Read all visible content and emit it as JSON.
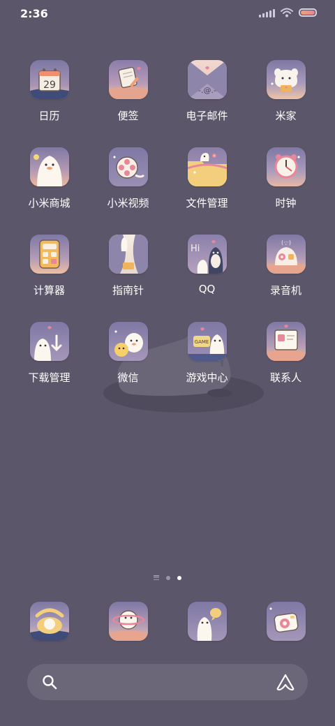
{
  "status_bar": {
    "time": "2:36",
    "signal_icon": "signal-icon",
    "wifi_icon": "wifi-icon",
    "battery_icon": "battery-icon"
  },
  "apps": [
    {
      "label": "日历",
      "icon": "calendar-icon",
      "date": "29"
    },
    {
      "label": "便签",
      "icon": "notes-icon"
    },
    {
      "label": "电子邮件",
      "icon": "email-icon"
    },
    {
      "label": "米家",
      "icon": "mijia-icon"
    },
    {
      "label": "小米商城",
      "icon": "mi-store-icon"
    },
    {
      "label": "小米视频",
      "icon": "mi-video-icon"
    },
    {
      "label": "文件管理",
      "icon": "file-manager-icon"
    },
    {
      "label": "时钟",
      "icon": "clock-icon"
    },
    {
      "label": "计算器",
      "icon": "calculator-icon"
    },
    {
      "label": "指南针",
      "icon": "compass-icon"
    },
    {
      "label": "QQ",
      "icon": "qq-icon",
      "badge_text": "Hi"
    },
    {
      "label": "录音机",
      "icon": "recorder-icon"
    },
    {
      "label": "下载管理",
      "icon": "downloads-icon"
    },
    {
      "label": "微信",
      "icon": "wechat-icon"
    },
    {
      "label": "游戏中心",
      "icon": "game-center-icon",
      "badge_text": "GAME"
    },
    {
      "label": "联系人",
      "icon": "contacts-icon"
    }
  ],
  "page_indicator": {
    "pages": 2,
    "active": 2
  },
  "dock": [
    {
      "icon": "phone-icon"
    },
    {
      "icon": "browser-icon"
    },
    {
      "icon": "messages-icon"
    },
    {
      "icon": "camera-icon"
    }
  ],
  "search": {
    "search_icon": "search-icon",
    "assistant_icon": "assistant-icon"
  },
  "colors": {
    "background": "#5b5669",
    "icon_bg_top": "#857aa6",
    "icon_bg_bottom": "#f0c3a8",
    "accent_pink": "#e8869a",
    "accent_orange": "#f0a077"
  }
}
